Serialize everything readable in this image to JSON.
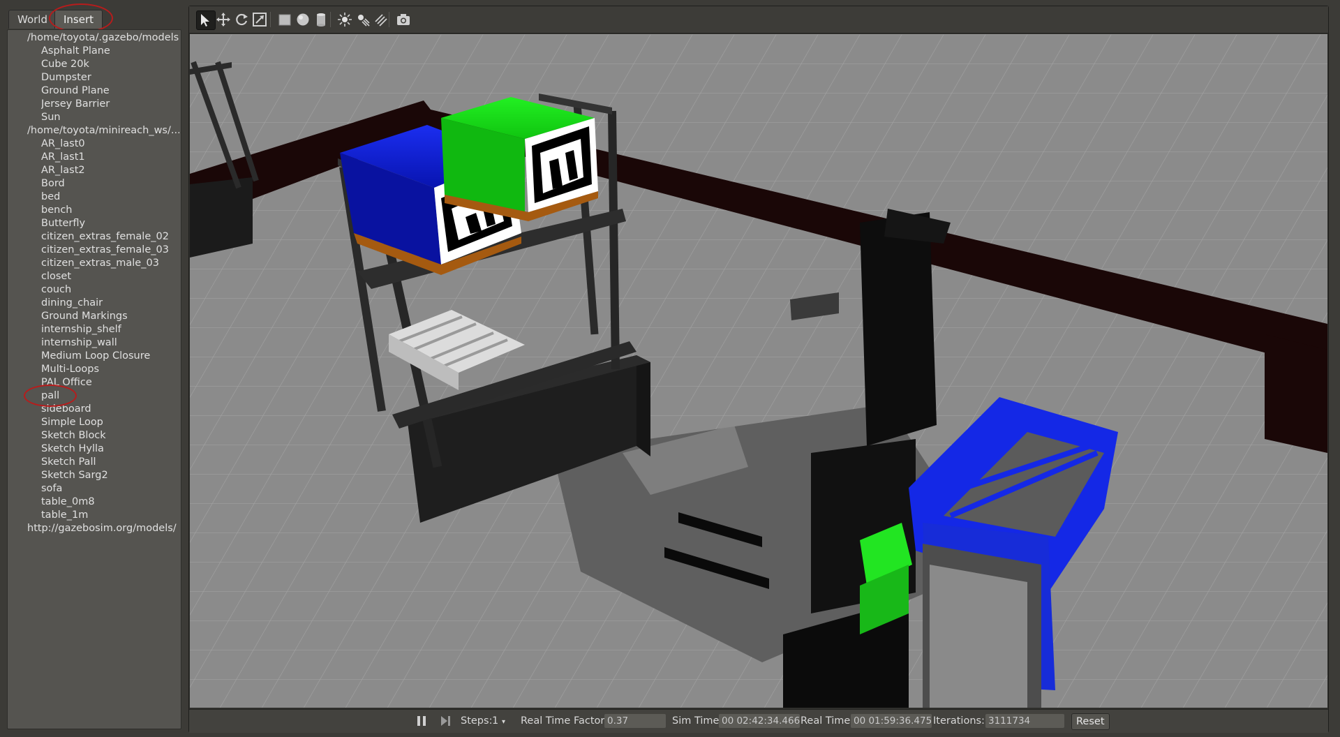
{
  "tabs": {
    "world": "World",
    "insert": "Insert"
  },
  "tree": {
    "groups": [
      {
        "path": "/home/toyota/.gazebo/models",
        "items": [
          "Asphalt Plane",
          "Cube 20k",
          "Dumpster",
          "Ground Plane",
          "Jersey Barrier",
          "Sun"
        ]
      },
      {
        "path": "/home/toyota/minireach_ws/...",
        "items": [
          "AR_last0",
          "AR_last1",
          "AR_last2",
          "Bord",
          "bed",
          "bench",
          "Butterfly",
          "citizen_extras_female_02",
          "citizen_extras_female_03",
          "citizen_extras_male_03",
          "closet",
          "couch",
          "dining_chair",
          "Ground Markings",
          "internship_shelf",
          "internship_wall",
          "Medium Loop Closure",
          "Multi-Loops",
          "PAL Office",
          "pall",
          "sideboard",
          "Simple Loop",
          "Sketch Block",
          "Sketch Hylla",
          "Sketch Pall",
          "Sketch Sarg2",
          "sofa",
          "table_0m8",
          "table_1m"
        ]
      },
      {
        "path": "http://gazebosim.org/models/",
        "items": []
      }
    ],
    "highlighted_item": "pall"
  },
  "toolbar": {
    "tools": [
      "select-icon",
      "translate-icon",
      "rotate-icon",
      "scale-icon",
      "box-shape-icon",
      "sphere-shape-icon",
      "cylinder-shape-icon",
      "point-light-icon",
      "spot-light-icon",
      "directional-light-icon",
      "screenshot-icon"
    ],
    "active_tool": "select-icon"
  },
  "status": {
    "steps_label": "Steps:",
    "steps_value": "1",
    "rtf_label": "Real Time Factor:",
    "rtf_value": "0.37",
    "sim_time_label": "Sim Time:",
    "sim_time_value": "00 02:42:34.466",
    "real_time_label": "Real Time:",
    "real_time_value": "00 01:59:36.475",
    "iterations_label": "Iterations:",
    "iterations_value": "3111734",
    "reset_label": "Reset"
  },
  "colors": {
    "accent_circle": "#b71c1c",
    "blue_box": "#0a14c8",
    "green_box": "#14dc14",
    "forklift_blue": "#1428e6"
  }
}
